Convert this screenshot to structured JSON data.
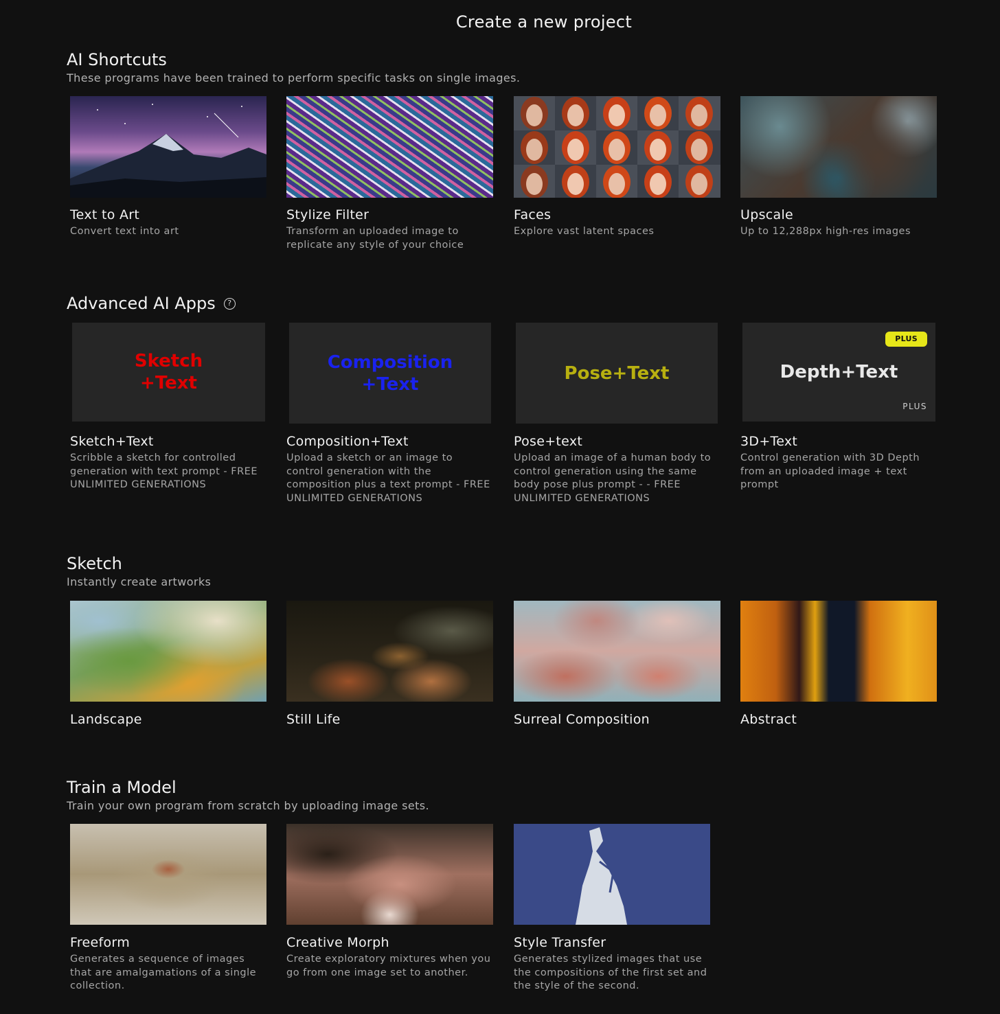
{
  "page_title": "Create a new project",
  "sections": {
    "shortcuts": {
      "title": "AI Shortcuts",
      "subtitle": "These programs have been trained to perform specific tasks on single images.",
      "cards": [
        {
          "title": "Text to Art",
          "desc": "Convert text into art"
        },
        {
          "title": "Stylize Filter",
          "desc": "Transform an uploaded image to replicate any style of your choice"
        },
        {
          "title": "Faces",
          "desc": "Explore vast latent spaces"
        },
        {
          "title": "Upscale",
          "desc": "Up to 12,288px high-res images"
        }
      ]
    },
    "advanced": {
      "title": "Advanced AI Apps",
      "cards": [
        {
          "tile_line1": "Sketch",
          "tile_line2": "+Text",
          "title": "Sketch+Text",
          "desc": "Scribble a sketch for controlled generation with text prompt - FREE UNLIMITED GENERATIONS",
          "color": "#e00000"
        },
        {
          "tile_line1": "Composition",
          "tile_line2": "+Text",
          "title": "Composition+Text",
          "desc": "Upload a sketch or an image to control generation with the composition plus a text prompt - FREE UNLIMITED GENERATIONS",
          "color": "#1a22ee"
        },
        {
          "tile_line1": "Pose+Text",
          "title": "Pose+text",
          "desc": "Upload an image of a human body to control generation using the same body pose plus prompt - - FREE UNLIMITED GENERATIONS",
          "color": "#b8b010"
        },
        {
          "tile_line1": "Depth+Text",
          "title": "3D+Text",
          "desc": "Control generation with 3D Depth from an uploaded image + text prompt",
          "color": "#e8e8e8",
          "badge": "PLUS",
          "plus_label": "PLUS"
        }
      ]
    },
    "sketch": {
      "title": "Sketch",
      "subtitle": "Instantly create artworks",
      "cards": [
        {
          "title": "Landscape"
        },
        {
          "title": "Still Life"
        },
        {
          "title": "Surreal Composition"
        },
        {
          "title": "Abstract"
        }
      ]
    },
    "train": {
      "title": "Train a Model",
      "subtitle": "Train your own program from scratch by uploading image sets.",
      "cards": [
        {
          "title": "Freeform",
          "desc": "Generates a sequence of images that are amalgamations of a single collection."
        },
        {
          "title": "Creative Morph",
          "desc": "Create exploratory mixtures when you go from one image set to another."
        },
        {
          "title": "Style Transfer",
          "desc": "Generates stylized images that use the compositions of the first set and the style of the second."
        }
      ]
    }
  },
  "icons": {
    "help": "help-circle-icon"
  }
}
